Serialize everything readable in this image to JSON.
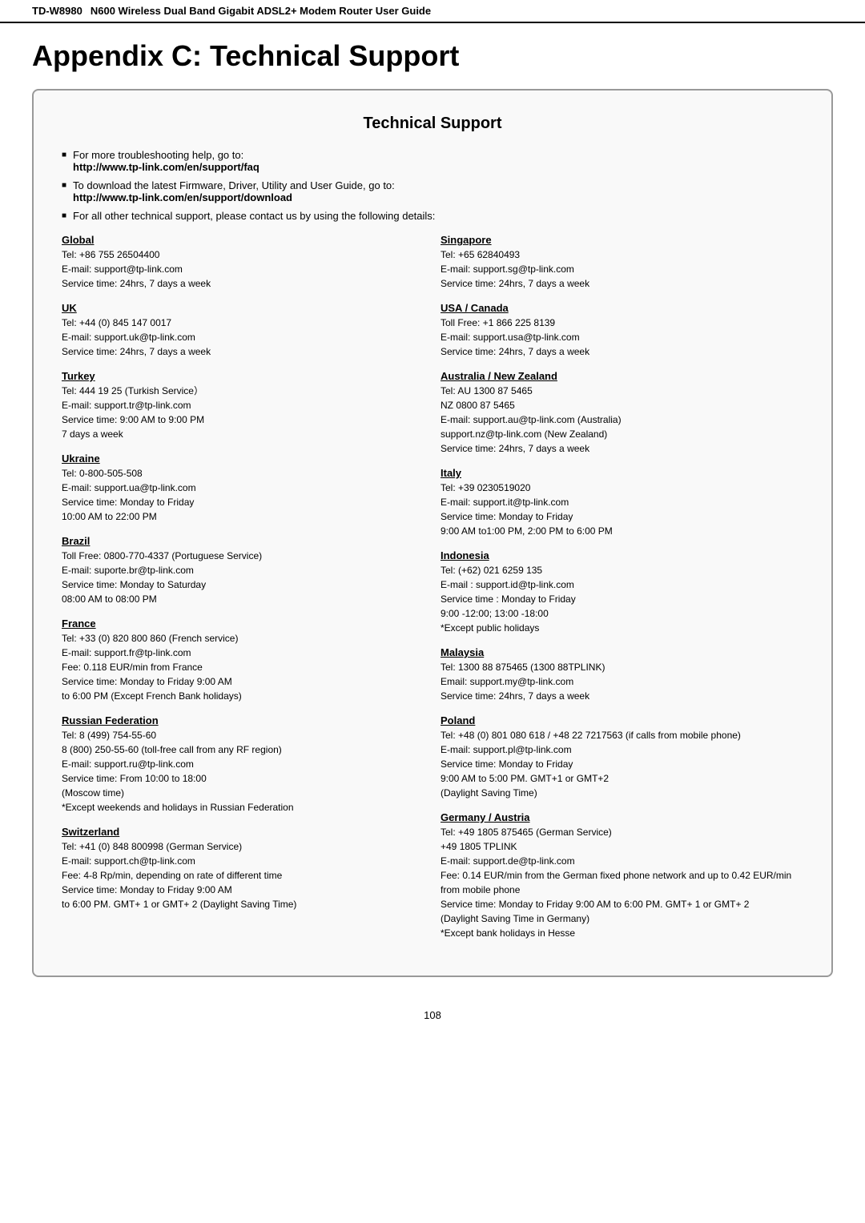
{
  "header": {
    "model": "TD-W8980",
    "title": "N600 Wireless Dual Band Gigabit ADSL2+ Modem Router User Guide"
  },
  "page_title": "Appendix C: Technical Support",
  "section_title": "Technical Support",
  "bullets": [
    {
      "text": "For more troubleshooting help, go to:",
      "link": "http://www.tp-link.com/en/support/faq"
    },
    {
      "text": "To download the latest Firmware, Driver, Utility and User Guide, go to:",
      "link": "http://www.tp-link.com/en/support/download"
    },
    {
      "text": "For all other technical support, please contact us by using the following details:",
      "link": null
    }
  ],
  "regions_left": [
    {
      "name": "Global",
      "info": "Tel: +86 755 26504400\nE-mail: support@tp-link.com\nService time: 24hrs, 7 days a week"
    },
    {
      "name": "UK",
      "info": "Tel: +44 (0) 845 147 0017\nE-mail: support.uk@tp-link.com\nService time: 24hrs, 7 days a week"
    },
    {
      "name": "Turkey",
      "info": "Tel: 444 19 25 (Turkish Service）\nE-mail: support.tr@tp-link.com\nService time: 9:00 AM to 9:00 PM\n7 days a week"
    },
    {
      "name": "Ukraine",
      "info": "Tel: 0-800-505-508\nE-mail: support.ua@tp-link.com\nService time: Monday to Friday\n10:00 AM to 22:00 PM"
    },
    {
      "name": "Brazil",
      "info": "Toll Free: 0800-770-4337 (Portuguese Service)\nE-mail: suporte.br@tp-link.com\nService time: Monday to Saturday\n08:00 AM to 08:00 PM"
    },
    {
      "name": "France",
      "info": "Tel: +33 (0) 820 800 860 (French service)\nE-mail: support.fr@tp-link.com\nFee: 0.118 EUR/min from France\nService time: Monday to Friday 9:00 AM\nto 6:00 PM (Except French Bank holidays)"
    },
    {
      "name": "Russian Federation",
      "info": "Tel: 8 (499) 754-55-60\n8 (800) 250-55-60 (toll-free call from any RF region)\nE-mail: support.ru@tp-link.com\nService time: From 10:00 to 18:00\n(Moscow time)\n*Except weekends and holidays in Russian Federation"
    },
    {
      "name": "Switzerland",
      "info": "Tel: +41 (0) 848 800998 (German Service)\nE-mail: support.ch@tp-link.com\nFee: 4-8 Rp/min, depending on rate of different time\nService time: Monday to Friday 9:00 AM\nto 6:00 PM. GMT+ 1 or GMT+ 2 (Daylight Saving Time)"
    }
  ],
  "regions_right": [
    {
      "name": "Singapore",
      "info": "Tel: +65 62840493\nE-mail: support.sg@tp-link.com\nService time: 24hrs, 7 days a week"
    },
    {
      "name": "USA / Canada",
      "info": "Toll Free: +1 866 225 8139\nE-mail: support.usa@tp-link.com\nService time: 24hrs, 7 days a week"
    },
    {
      "name": "Australia / New Zealand",
      "info": "Tel: AU 1300 87 5465\nNZ 0800 87 5465\nE-mail: support.au@tp-link.com (Australia)\nsupport.nz@tp-link.com (New Zealand)\nService time: 24hrs, 7 days a week"
    },
    {
      "name": "Italy",
      "info": "Tel: +39 0230519020\nE-mail: support.it@tp-link.com\nService time: Monday to Friday\n9:00 AM to1:00 PM, 2:00 PM to 6:00 PM"
    },
    {
      "name": "Indonesia",
      "info": "Tel: (+62) 021 6259 135\nE-mail : support.id@tp-link.com\nService time : Monday to Friday\n9:00 -12:00; 13:00 -18:00\n*Except public holidays"
    },
    {
      "name": "Malaysia",
      "info": "Tel: 1300 88 875465 (1300 88TPLINK)\nEmail: support.my@tp-link.com\nService time: 24hrs, 7 days a week"
    },
    {
      "name": "Poland",
      "info": "Tel: +48 (0) 801 080 618 / +48 22 7217563 (if calls from mobile phone)\nE-mail: support.pl@tp-link.com\nService time: Monday to Friday\n9:00 AM to 5:00 PM. GMT+1 or GMT+2\n(Daylight Saving Time)"
    },
    {
      "name": "Germany / Austria",
      "info": "Tel: +49 1805 875465 (German Service)\n+49 1805 TPLINK\nE-mail: support.de@tp-link.com\nFee: 0.14 EUR/min from the German fixed phone network and up to 0.42 EUR/min from mobile phone\nService time: Monday to Friday 9:00 AM to 6:00 PM. GMT+ 1 or GMT+ 2\n(Daylight Saving Time in Germany)\n*Except bank holidays in Hesse"
    }
  ],
  "page_number": "108"
}
